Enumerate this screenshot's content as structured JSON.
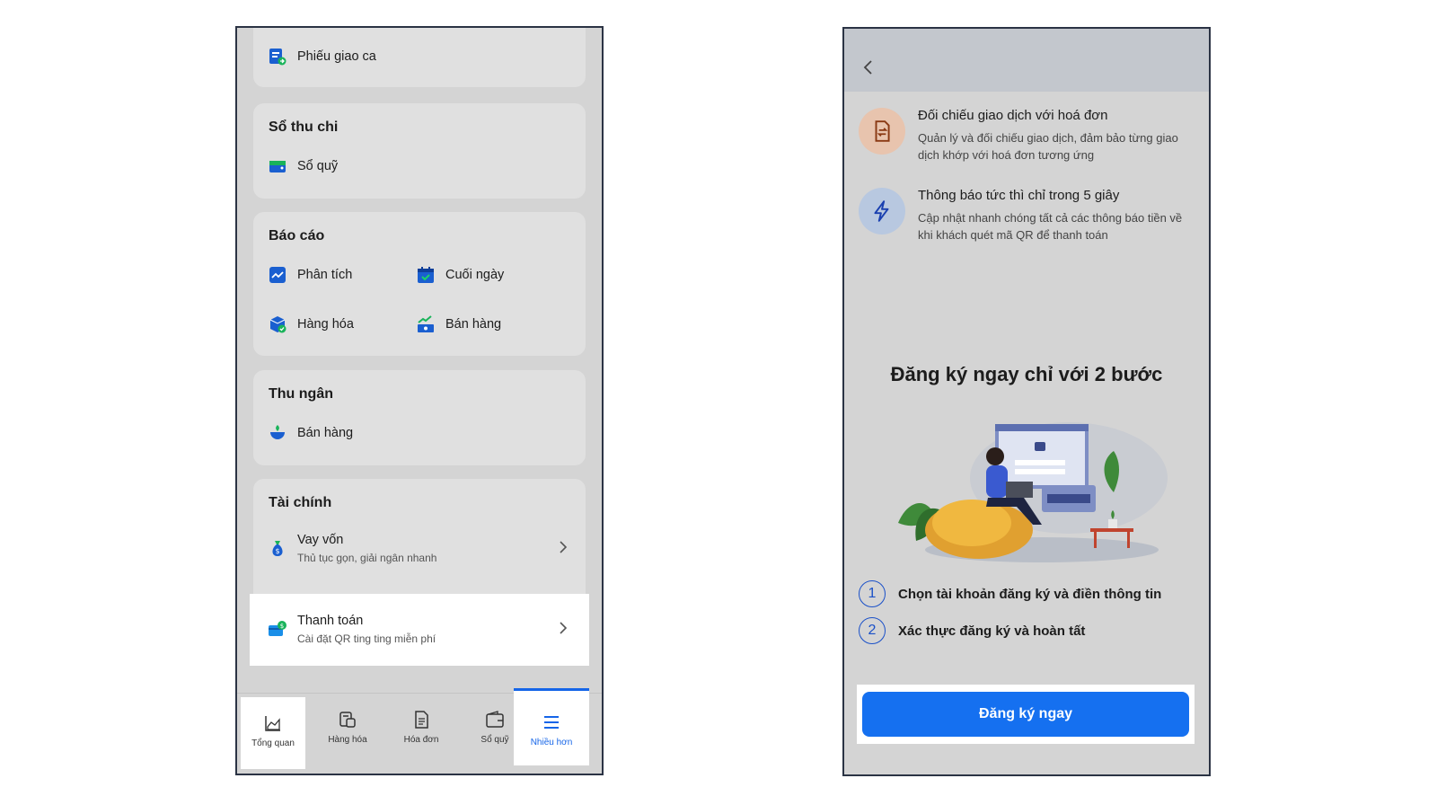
{
  "left": {
    "shift_card": {
      "item": "Phiếu giao ca"
    },
    "cashbook_card": {
      "title": "Sổ thu chi",
      "items": [
        "Sổ quỹ"
      ]
    },
    "reports_card": {
      "title": "Báo cáo",
      "items": [
        "Phân tích",
        "Cuối ngày",
        "Hàng hóa",
        "Bán hàng"
      ]
    },
    "cashier_card": {
      "title": "Thu ngân",
      "items": [
        "Bán hàng"
      ]
    },
    "finance_card": {
      "title": "Tài chính",
      "rows": [
        {
          "title": "Vay vốn",
          "subtitle": "Thủ tục gọn, giải ngân nhanh"
        },
        {
          "title": "Thanh toán",
          "subtitle": "Cài đặt QR ting ting miễn phí"
        }
      ]
    },
    "tabbar": [
      {
        "label": "Tổng quan",
        "icon": "chart-area-icon"
      },
      {
        "label": "Hàng hóa",
        "icon": "goods-icon"
      },
      {
        "label": "Hóa đơn",
        "icon": "invoice-icon"
      },
      {
        "label": "Sổ quỹ",
        "icon": "wallet-icon"
      },
      {
        "label": "Nhiều hơn",
        "icon": "menu-icon"
      }
    ],
    "active_tab": "Nhiều hơn"
  },
  "right": {
    "features": [
      {
        "title": "Đối chiếu giao dịch với hoá đơn",
        "desc": "Quản lý và đối chiếu giao dịch, đảm bảo từng giao dịch khớp với hoá đơn tương ứng",
        "icon": "document-compare-icon",
        "color": "#e8c4ae"
      },
      {
        "title": "Thông báo tức thì chỉ trong 5 giây",
        "desc": "Cập nhật nhanh chóng tất cả các thông báo tiền về khi khách quét mã QR để thanh toán",
        "icon": "lightning-icon",
        "color": "#b8c8e0"
      }
    ],
    "headline": "Đăng ký ngay chỉ với 2 bước",
    "steps": [
      {
        "num": "1",
        "text": "Chọn tài khoản đăng ký và điền thông tin"
      },
      {
        "num": "2",
        "text": "Xác thực đăng ký và hoàn tất"
      }
    ],
    "cta": "Đăng ký ngay",
    "accent": "#1570f0"
  }
}
